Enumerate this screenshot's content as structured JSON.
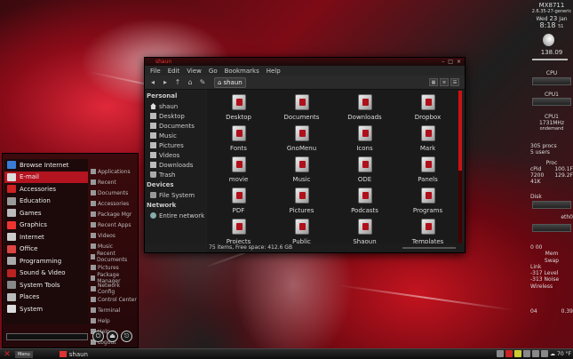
{
  "file_manager": {
    "window_title": "shaun",
    "menu": [
      "File",
      "Edit",
      "View",
      "Go",
      "Bookmarks",
      "Help"
    ],
    "location": "shaun",
    "sidebar": {
      "personal_header": "Personal",
      "personal": [
        "shaun",
        "Desktop",
        "Documents",
        "Music",
        "Pictures",
        "Videos",
        "Downloads",
        "Trash"
      ],
      "devices_header": "Devices",
      "devices": [
        "File System"
      ],
      "network_header": "Network",
      "network": [
        "Entire network"
      ]
    },
    "items": [
      "Desktop",
      "Documents",
      "Downloads",
      "Dropbox",
      "Fonts",
      "GnoMenu",
      "Icons",
      "Mark",
      "movie",
      "Music",
      "ODE",
      "Panels",
      "PDF",
      "Pictures",
      "Podcasts",
      "Programs",
      "Projects",
      "Public",
      "Shaoun",
      "Templates"
    ],
    "status": "75 items, Free space: 412.6 GB"
  },
  "app_menu": {
    "items": [
      "Browse Internet",
      "E-mail",
      "Accessories",
      "Education",
      "Games",
      "Graphics",
      "Internet",
      "Office",
      "Programming",
      "Sound & Video",
      "System Tools",
      "Places",
      "System"
    ],
    "selected_index": 1,
    "right_items": [
      "Applications",
      "Recent",
      "Documents",
      "Accessories",
      "Package Mgr",
      "Recent Apps",
      "Videos",
      "Music",
      "Recent Documents",
      "Pictures",
      "Package Manager",
      "Network Config",
      "Control Center",
      "Terminal",
      "Help",
      "Help",
      "Logout"
    ]
  },
  "conky": {
    "hostname": "MX8711",
    "kernel": "2.6.35-27-generic",
    "day": "Wed",
    "date": "23",
    "month": "Jan",
    "time": "8:18",
    "seconds": "51",
    "uptime": "138.09",
    "cpu_labels": [
      "CPU",
      "CPU1",
      "CPU1"
    ],
    "freq": "1731MHz",
    "gov": "ondemand",
    "procs": "305 procs",
    "users": "5 users",
    "proc_head": "Proc",
    "proc_vals": [
      "100.1F",
      "129.2F"
    ],
    "proc_left": [
      "cPid",
      "7200"
    ],
    "mem_small": "41K",
    "disk_label": "Disk",
    "eth": "eth0",
    "mem_label": "Mem",
    "swap_label": "Swap",
    "mem_nums": [
      "0 00",
      "0 00"
    ],
    "link": "Link",
    "level": "-317 Level",
    "noise": "-313 Noise",
    "wireless": "Wireless",
    "clock_footer": [
      "04",
      "0.39"
    ]
  },
  "taskbar": {
    "menu_label": "Menu",
    "task": "shaun",
    "tray_temp": "70 °F"
  },
  "colors": {
    "accent": "#b31420",
    "window_bg": "#1f1f1f"
  }
}
